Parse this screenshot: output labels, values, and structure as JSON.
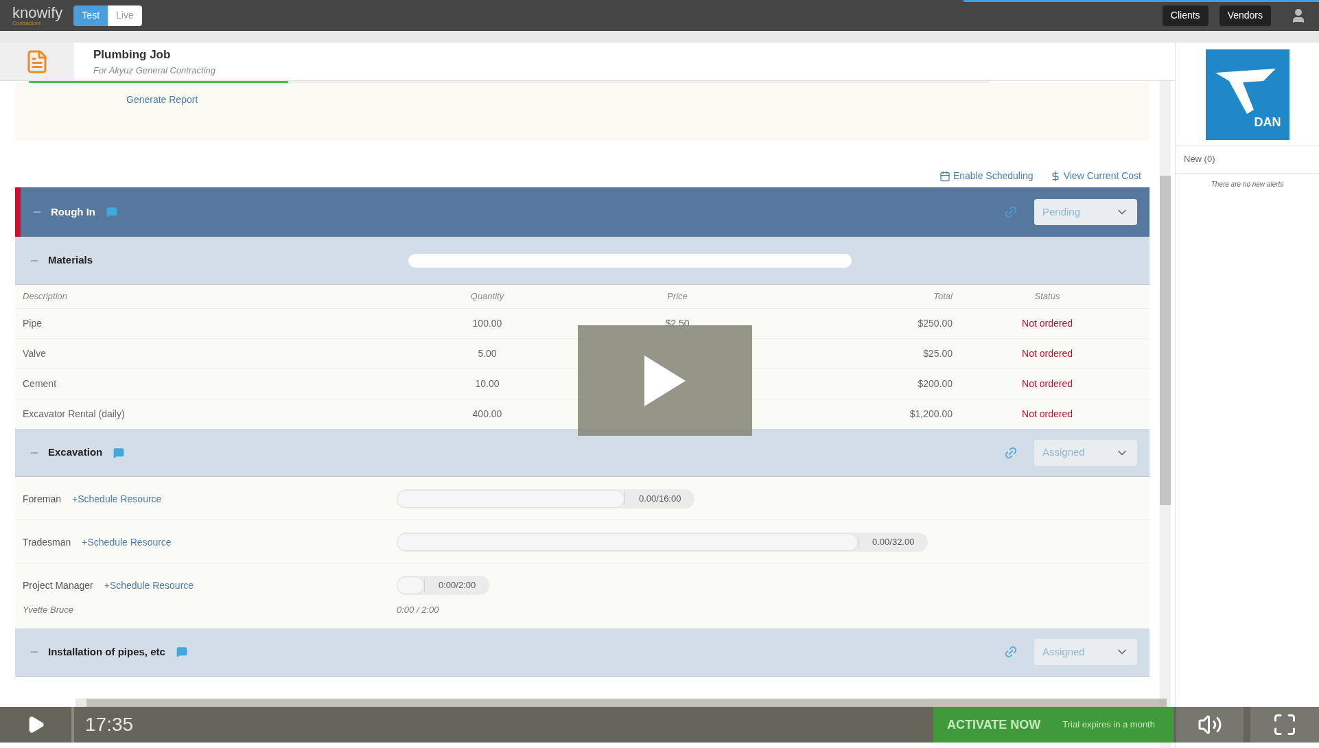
{
  "topbar": {
    "logo": "knowify",
    "logo_sub": "Contractors",
    "modes": [
      {
        "label": "Test",
        "selected": true
      },
      {
        "label": "Live",
        "selected": false
      }
    ],
    "nav_buttons": [
      "Clients",
      "Vendors"
    ]
  },
  "job": {
    "title": "Plumbing Job",
    "subtitle": "For Akyuz General Contracting",
    "progress": {
      "level": 0.27
    },
    "generate_report": "Generate Report"
  },
  "actions": [
    {
      "kind": "calendar",
      "label": "Enable Scheduling"
    },
    {
      "kind": "dollar",
      "label": "View Current Cost"
    }
  ],
  "phase": {
    "title": "Rough In",
    "status": "Pending",
    "current": true,
    "tasks": [
      {
        "kind": "materials",
        "title": "Materials",
        "columns": [
          "Description",
          "Quantity",
          "Price",
          "Total",
          "Status"
        ],
        "rows": [
          {
            "description": "Pipe",
            "quantity": "100.00",
            "price": "$2.50",
            "total": "$250.00",
            "status": "Not ordered"
          },
          {
            "description": "Valve",
            "quantity": "5.00",
            "total": "$25.00",
            "status": "Not ordered"
          },
          {
            "description": "Cement",
            "quantity": "10.00",
            "total": "$200.00",
            "status": "Not ordered"
          },
          {
            "description": "Excavator Rental (daily)",
            "quantity": "400.00",
            "total": "$1,200.00",
            "status": "Not ordered"
          }
        ]
      },
      {
        "kind": "labor",
        "title": "Excavation",
        "status": "Assigned",
        "resources": [
          {
            "role": "Foreman",
            "link": "+Schedule Resource",
            "hours": "0.00/16:00"
          },
          {
            "role": "Tradesman",
            "link": "+Schedule Resource",
            "hours": "0.00/32.00"
          },
          {
            "role": "Project Manager",
            "link": "+Schedule Resource",
            "hours": "0:00/2:00",
            "assignee": {
              "name": "Yvette Bruce",
              "hours": "0:00 / 2:00"
            }
          }
        ]
      },
      {
        "kind": "labor",
        "title": "Installation of pipes, etc",
        "status": "Assigned"
      }
    ]
  },
  "sidebar": {
    "logo_text": "DAN",
    "alerts_tab": "New (0)",
    "empty_message": "There are no new alerts"
  },
  "player": {
    "time": "17:35",
    "activate": "ACTIVATE NOW",
    "trial": "Trial expires in a month",
    "progress": {
      "level": 0.01
    }
  }
}
